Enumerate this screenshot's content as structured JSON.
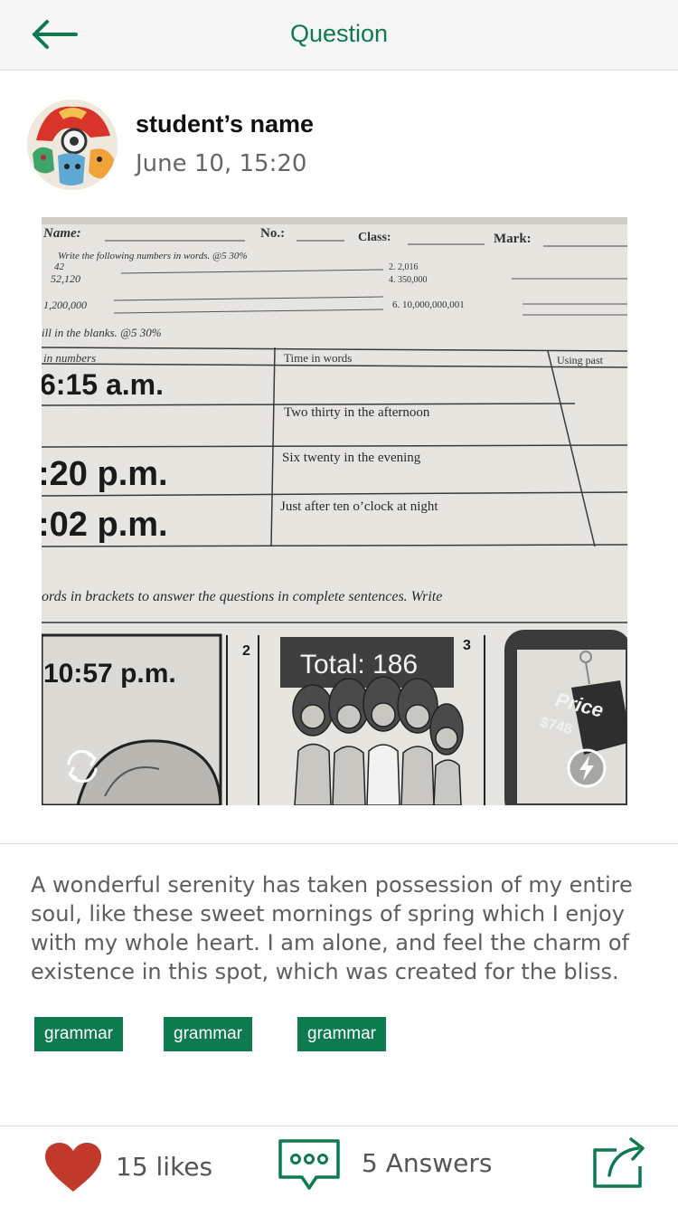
{
  "header": {
    "title": "Question",
    "back_icon": "arrow-left-icon",
    "accent_color": "#0e7a4f"
  },
  "author": {
    "name": "student’s name",
    "time": "June 10, 15:20",
    "avatar_icon": "avatar-image"
  },
  "photo": {
    "worksheet": {
      "header_name": "Name:",
      "header_no": "No.:",
      "header_class": "Class:",
      "header_mark": "Mark:",
      "instruction_1": "Write the following numbers in words. @5 30%",
      "n1": "42",
      "n2": "52,120",
      "n3": "1,200,000",
      "n4": "2.  2,016",
      "n5": "4.  350,000",
      "n6": "6.  10,000,000,001",
      "instruction_2": "ill in the blanks. @5 30%",
      "col_numbers": "in numbers",
      "col_words": "Time in words",
      "col_past": "Using past",
      "row1_num": "6:15 a.m.",
      "row2_words": "Two thirty in the afternoon",
      "row3_num": ":20 p.m.",
      "row3_words": "Six twenty in the evening",
      "row4_num": ":02 p.m.",
      "row4_words": "Just after ten o’clock at night",
      "instruction_3": "ords in brackets to answer the questions in complete sentences. Write",
      "panel1_time": "10:57 p.m.",
      "panel2_num": "2",
      "panel2_total": "Total: 186",
      "panel3_num": "3",
      "price_tag": "Price",
      "price_amount": "$748"
    },
    "rotate_icon": "rotate-icon",
    "flash_icon": "flash-icon"
  },
  "description": "A wonderful serenity has taken possession of my entire soul, like these sweet mornings of spring which I enjoy with my whole heart. I am alone, and feel the charm of existence in this spot, which was created for the bliss.",
  "tags": [
    "grammar",
    "grammar",
    "grammar"
  ],
  "footer": {
    "likes_label": "15 likes",
    "answers_label": "5 Answers",
    "heart_color": "#c0392b",
    "like_icon": "heart-icon",
    "answers_icon": "chat-bubble-icon",
    "share_icon": "share-icon"
  }
}
